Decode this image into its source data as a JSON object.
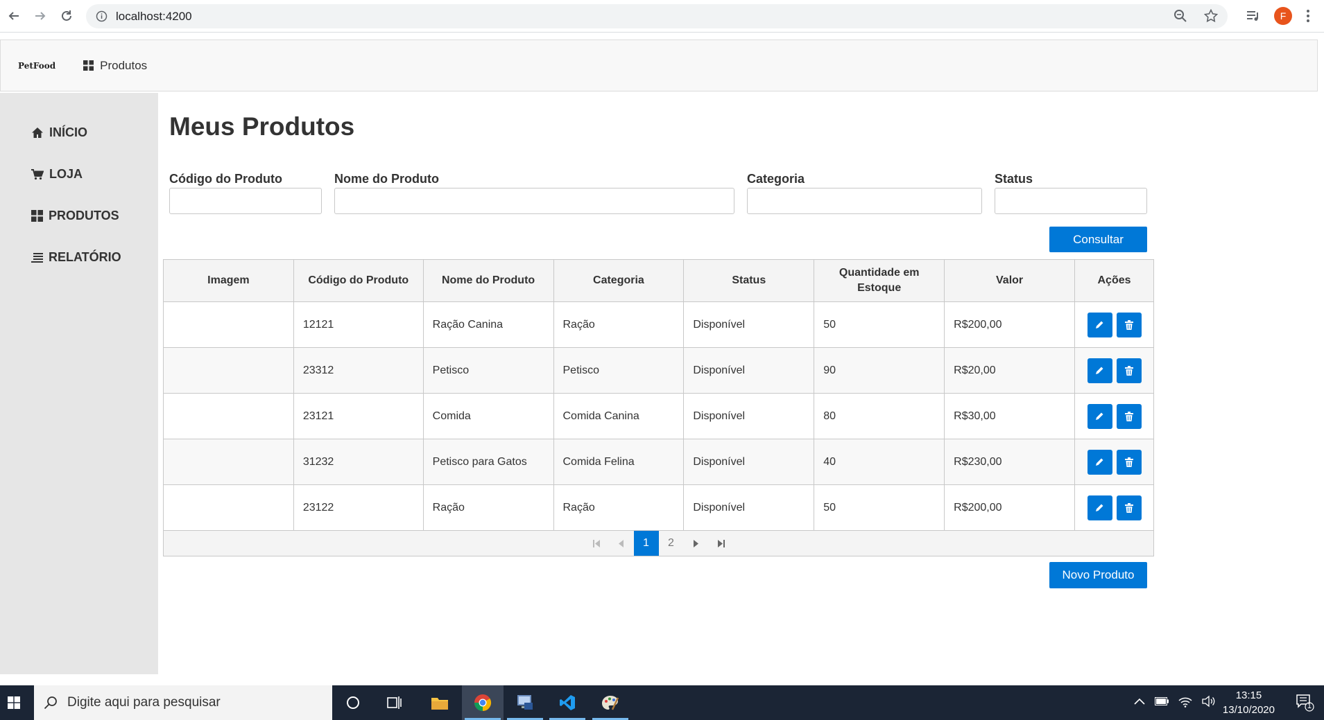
{
  "browser": {
    "url": "localhost:4200",
    "profile_initial": "F",
    "accent": "#e8541c"
  },
  "topbar": {
    "brand": "PetFood",
    "nav_label": "Produtos"
  },
  "sidebar": {
    "items": [
      {
        "label": "INÍCIO",
        "icon": "home-icon"
      },
      {
        "label": "LOJA",
        "icon": "cart-icon"
      },
      {
        "label": "PRODUTOS",
        "icon": "grid-icon"
      },
      {
        "label": "RELATÓRIO",
        "icon": "list-icon"
      }
    ]
  },
  "main": {
    "title": "Meus Produtos",
    "filters": {
      "codigo_label": "Código do Produto",
      "codigo_value": "",
      "nome_label": "Nome do Produto",
      "nome_value": "",
      "categoria_label": "Categoria",
      "categoria_value": "",
      "status_label": "Status",
      "status_value": ""
    },
    "consultar_label": "Consultar",
    "novo_label": "Novo Produto",
    "accent": "#0078d7"
  },
  "table": {
    "headers": [
      "Imagem",
      "Código do Produto",
      "Nome do Produto",
      "Categoria",
      "Status",
      "Quantidade em Estoque",
      "Valor",
      "Ações"
    ],
    "rows": [
      {
        "imagem": "",
        "codigo": "12121",
        "nome": "Ração Canina",
        "categoria": "Ração",
        "status": "Disponível",
        "quantidade": "50",
        "valor": "R$200,00"
      },
      {
        "imagem": "",
        "codigo": "23312",
        "nome": "Petisco",
        "categoria": "Petisco",
        "status": "Disponível",
        "quantidade": "90",
        "valor": "R$20,00"
      },
      {
        "imagem": "",
        "codigo": "23121",
        "nome": "Comida",
        "categoria": "Comida Canina",
        "status": "Disponível",
        "quantidade": "80",
        "valor": "R$30,00"
      },
      {
        "imagem": "",
        "codigo": "31232",
        "nome": "Petisco para Gatos",
        "categoria": "Comida Felina",
        "status": "Disponível",
        "quantidade": "40",
        "valor": "R$230,00"
      },
      {
        "imagem": "",
        "codigo": "23122",
        "nome": "Ração",
        "categoria": "Ração",
        "status": "Disponível",
        "quantidade": "50",
        "valor": "R$200,00"
      }
    ]
  },
  "paginator": {
    "pages": [
      "1",
      "2"
    ],
    "current": "1"
  },
  "taskbar": {
    "search_placeholder": "Digite aqui para pesquisar",
    "time": "13:15",
    "date": "13/10/2020",
    "notification_count": "1"
  }
}
